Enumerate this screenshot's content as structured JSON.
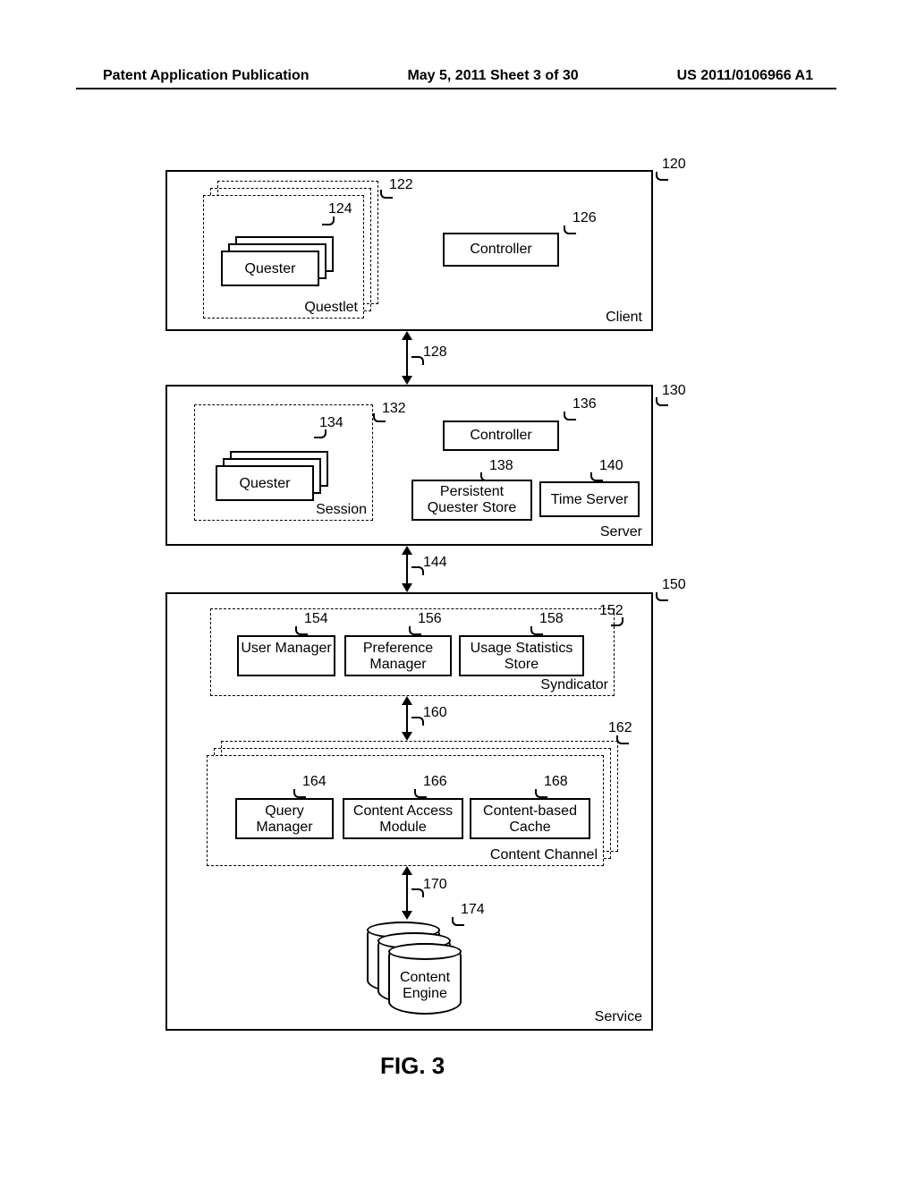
{
  "header": {
    "left": "Patent Application Publication",
    "center": "May 5, 2011  Sheet 3 of 30",
    "right": "US 2011/0106966 A1"
  },
  "figure_caption": "FIG. 3",
  "client": {
    "label": "Client",
    "ref": "120",
    "questlet": {
      "label": "Questlet",
      "ref": "122"
    },
    "quester": {
      "label": "Quester",
      "ref": "124"
    },
    "controller": {
      "label": "Controller",
      "ref": "126"
    }
  },
  "conn_client_server": {
    "ref": "128"
  },
  "server": {
    "label": "Server",
    "ref": "130",
    "session": {
      "label": "Session",
      "ref": "132"
    },
    "quester": {
      "label": "Quester",
      "ref": "134"
    },
    "controller": {
      "label": "Controller",
      "ref": "136"
    },
    "persistent_store": {
      "label": "Persistent Quester Store",
      "ref": "138"
    },
    "time_server": {
      "label": "Time Server",
      "ref": "140"
    }
  },
  "conn_server_service": {
    "ref": "144"
  },
  "service": {
    "label": "Service",
    "ref": "150",
    "syndicator": {
      "label": "Syndicator",
      "ref": "152",
      "user_manager": {
        "label": "User Manager",
        "ref": "154"
      },
      "preference_manager": {
        "label": "Preference Manager",
        "ref": "156"
      },
      "usage_stats": {
        "label": "Usage Statistics Store",
        "ref": "158"
      }
    },
    "conn_synd_channel": {
      "ref": "160"
    },
    "content_channel": {
      "label": "Content Channel",
      "ref": "162",
      "query_manager": {
        "label": "Query Manager",
        "ref": "164"
      },
      "content_access": {
        "label": "Content Access Module",
        "ref": "166"
      },
      "content_cache": {
        "label": "Content-based Cache",
        "ref": "168"
      }
    },
    "conn_channel_engine": {
      "ref": "170"
    },
    "content_engine": {
      "label": "Content Engine",
      "ref": "174"
    }
  },
  "chart_data": {
    "type": "diagram",
    "title": "FIG. 3 — System architecture block diagram",
    "blocks": [
      {
        "id": 120,
        "name": "Client",
        "children": [
          {
            "id": 122,
            "name": "Questlet",
            "children": [
              {
                "id": 124,
                "name": "Quester"
              }
            ]
          },
          {
            "id": 126,
            "name": "Controller"
          }
        ]
      },
      {
        "id": 130,
        "name": "Server",
        "children": [
          {
            "id": 132,
            "name": "Session",
            "children": [
              {
                "id": 134,
                "name": "Quester"
              }
            ]
          },
          {
            "id": 136,
            "name": "Controller"
          },
          {
            "id": 138,
            "name": "Persistent Quester Store"
          },
          {
            "id": 140,
            "name": "Time Server"
          }
        ]
      },
      {
        "id": 150,
        "name": "Service",
        "children": [
          {
            "id": 152,
            "name": "Syndicator",
            "children": [
              {
                "id": 154,
                "name": "User Manager"
              },
              {
                "id": 156,
                "name": "Preference Manager"
              },
              {
                "id": 158,
                "name": "Usage Statistics Store"
              }
            ]
          },
          {
            "id": 162,
            "name": "Content Channel",
            "children": [
              {
                "id": 164,
                "name": "Query Manager"
              },
              {
                "id": 166,
                "name": "Content Access Module"
              },
              {
                "id": 168,
                "name": "Content-based Cache"
              }
            ]
          },
          {
            "id": 174,
            "name": "Content Engine"
          }
        ]
      }
    ],
    "connections": [
      {
        "id": 128,
        "from": 120,
        "to": 130,
        "bidirectional": true
      },
      {
        "id": 144,
        "from": 130,
        "to": 150,
        "bidirectional": true
      },
      {
        "id": 160,
        "from": 152,
        "to": 162,
        "bidirectional": true
      },
      {
        "id": 170,
        "from": 162,
        "to": 174,
        "bidirectional": true
      }
    ]
  }
}
